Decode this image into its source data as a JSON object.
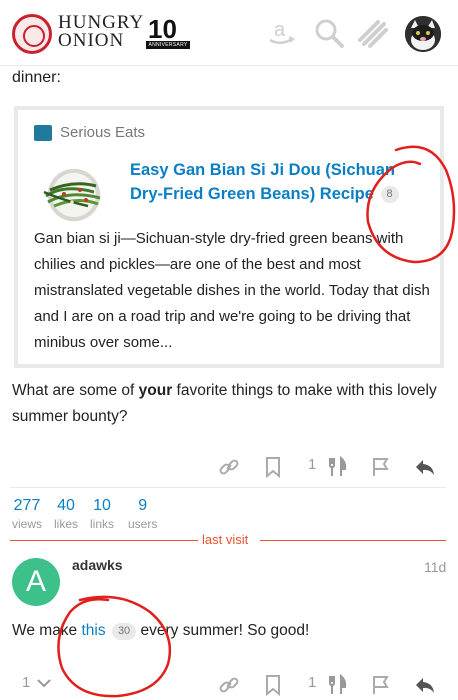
{
  "header": {
    "logo_line1": "HUNGRY",
    "logo_line2": "ONION",
    "anniversary_number": "10",
    "anniversary_banner": "ANNIVERSARY",
    "icons": [
      "amazon-icon",
      "search-icon",
      "hamburger-menu-icon"
    ],
    "avatar_icon": "user-avatar-cat"
  },
  "post": {
    "intro_text": "dinner:",
    "onebox": {
      "source": "Serious Eats",
      "title": "Easy Gan Bian Si Ji Dou (Sichuan Dry-Fried Green Beans) Recipe",
      "click_count": "8",
      "description": "Gan bian si ji—Sichuan-style dry-fried green beans with chilies and pickles—are one of the best and most mistranslated vegetable dishes in the world. Today that dish and I are on a road trip and we're going to be driving that minibus over some..."
    },
    "question_before": "What are some of ",
    "question_bold": "your",
    "question_after": " favorite things to make with this lovely summer bounty?",
    "actions": {
      "like_count": "1",
      "icons": [
        "link-icon",
        "bookmark-icon",
        "fork-knife-icon",
        "flag-icon",
        "reply-icon"
      ]
    }
  },
  "stats": [
    {
      "num": "277",
      "label": "views"
    },
    {
      "num": "40",
      "label": "likes"
    },
    {
      "num": "10",
      "label": "links"
    },
    {
      "num": "9",
      "label": "users"
    }
  ],
  "last_visit": "last visit",
  "reply": {
    "avatar_letter": "A",
    "avatar_color": "#3dc08a",
    "username": "adawks",
    "date": "11d",
    "body_before": "We make ",
    "link_text": "this",
    "link_clicks": "30",
    "body_after": " every summer! So good!",
    "likes_toggle_count": "1",
    "like_count": "1"
  },
  "colors": {
    "link": "#0a7fc4",
    "last_visit": "#e8542e",
    "annotation": "#e0201c"
  }
}
